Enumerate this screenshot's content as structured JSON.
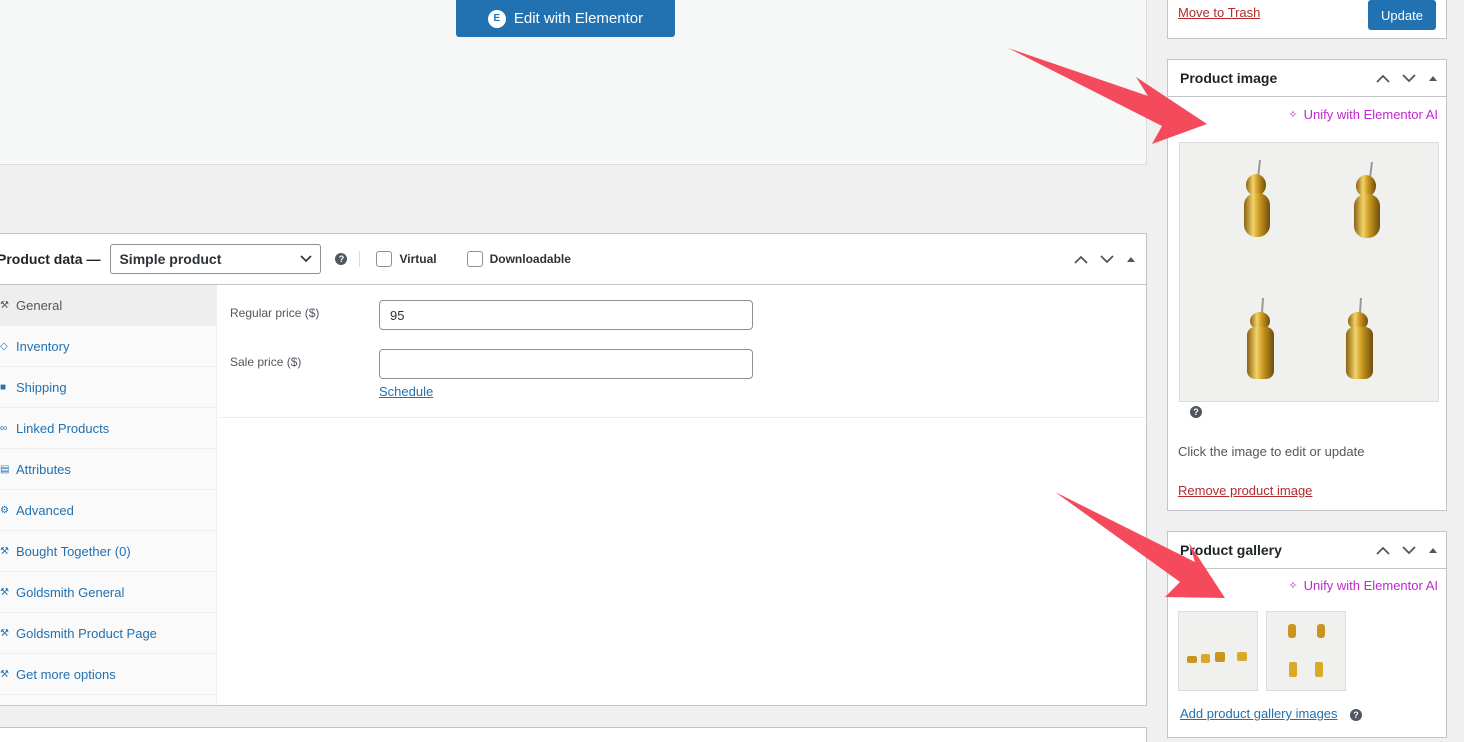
{
  "editor": {
    "elementor_button": "Edit with Elementor"
  },
  "product_data": {
    "title": "Product data —",
    "type_select": "Simple product",
    "virtual_label": "Virtual",
    "downloadable_label": "Downloadable",
    "tabs": [
      {
        "label": "General",
        "icon": "wrench-icon"
      },
      {
        "label": "Inventory",
        "icon": "tag-icon"
      },
      {
        "label": "Shipping",
        "icon": "truck-icon"
      },
      {
        "label": "Linked Products",
        "icon": "link-icon"
      },
      {
        "label": "Attributes",
        "icon": "list-icon"
      },
      {
        "label": "Advanced",
        "icon": "gear-icon"
      },
      {
        "label": "Bought Together (0)",
        "icon": "wrench-icon"
      },
      {
        "label": "Goldsmith General",
        "icon": "wrench-icon"
      },
      {
        "label": "Goldsmith Product Page",
        "icon": "wrench-icon"
      },
      {
        "label": "Get more options",
        "icon": "wrench-icon"
      }
    ],
    "regular_price_label": "Regular price ($)",
    "regular_price_value": "95",
    "sale_price_label": "Sale price ($)",
    "sale_price_value": "",
    "schedule_link": "Schedule"
  },
  "publish": {
    "trash_link": "Move to Trash",
    "update_button": "Update"
  },
  "product_image": {
    "title": "Product image",
    "ai_link": "Unify with Elementor AI",
    "note": "Click the image to edit or update",
    "remove_link": "Remove product image"
  },
  "product_gallery": {
    "title": "Product gallery",
    "ai_link": "Unify with Elementor AI",
    "add_link": "Add product gallery images"
  },
  "colors": {
    "accent": "#2271b1",
    "danger": "#b32d2e",
    "ai": "#c026d3",
    "annotation_arrow": "#f44a5c",
    "gold": "#d4a017"
  }
}
